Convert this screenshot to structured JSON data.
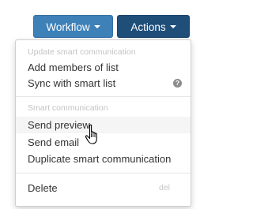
{
  "toolbar": {
    "workflow_label": "Workflow",
    "actions_label": "Actions"
  },
  "menu": {
    "section_update_header": "Update smart communication",
    "add_members_label": "Add members of list",
    "sync_label": "Sync with smart list",
    "help_icon_glyph": "?",
    "section_smart_header": "Smart communication",
    "send_preview_label": "Send preview",
    "send_email_label": "Send email",
    "duplicate_label": "Duplicate smart communication",
    "delete_label": "Delete",
    "delete_shortcut": "del"
  },
  "icons": {
    "caret": "chevron-down-icon",
    "help": "help-icon",
    "cursor": "hand-pointer-icon"
  },
  "colors": {
    "workflow_button": "#3e81b9",
    "actions_button": "#1f4e79",
    "menu_text": "#333333",
    "section_header_text": "#c3c3c3",
    "hover_background": "#f5f5f5"
  }
}
